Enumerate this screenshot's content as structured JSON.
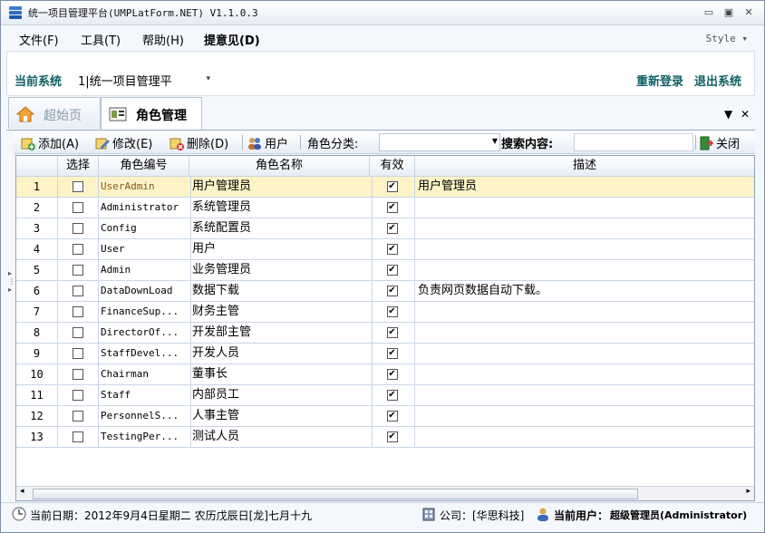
{
  "window": {
    "title": "统一项目管理平台(UMPLatForm.NET) V1.1.0.3",
    "controls": {
      "minimize": "▭",
      "restore": "▣",
      "close": "✕"
    }
  },
  "menu": {
    "items": [
      "文件(F)",
      "工具(T)",
      "帮助(H)",
      "提意见(D)"
    ],
    "style_label": "Style ▾"
  },
  "system": {
    "label": "当前系统",
    "selected": "1|统一项目管理平",
    "relogin": "重新登录",
    "logout": "退出系统"
  },
  "tabs": [
    {
      "label": "超始页",
      "icon": "home-icon",
      "active": false
    },
    {
      "label": "角色管理",
      "icon": "role-management-icon",
      "active": true
    }
  ],
  "toolbar": {
    "add": "添加(A)",
    "edit": "修改(E)",
    "delete": "删除(D)",
    "user": "用户",
    "category_label": "角色分类:",
    "category_value": "",
    "search_label": "搜索内容:",
    "search_value": "",
    "close": "关闭"
  },
  "grid": {
    "columns": [
      "选择",
      "角色编号",
      "角色名称",
      "有效",
      "描述"
    ],
    "rows": [
      {
        "num": "1",
        "code": "UserAdmin",
        "name": "用户管理员",
        "valid": true,
        "desc": "用户管理员",
        "checked": false
      },
      {
        "num": "2",
        "code": "Administrator",
        "name": "系统管理员",
        "valid": true,
        "desc": "",
        "checked": false
      },
      {
        "num": "3",
        "code": "Config",
        "name": "系统配置员",
        "valid": true,
        "desc": "",
        "checked": false
      },
      {
        "num": "4",
        "code": "User",
        "name": "用户",
        "valid": true,
        "desc": "",
        "checked": false
      },
      {
        "num": "5",
        "code": "Admin",
        "name": "业务管理员",
        "valid": true,
        "desc": "",
        "checked": false
      },
      {
        "num": "6",
        "code": "DataDownLoad",
        "name": "数据下载",
        "valid": true,
        "desc": "负责网页数据自动下载。",
        "checked": false
      },
      {
        "num": "7",
        "code": "FinanceSup...",
        "name": "财务主管",
        "valid": true,
        "desc": "",
        "checked": false
      },
      {
        "num": "8",
        "code": "DirectorOf...",
        "name": "开发部主管",
        "valid": true,
        "desc": "",
        "checked": false
      },
      {
        "num": "9",
        "code": "StaffDevel...",
        "name": "开发人员",
        "valid": true,
        "desc": "",
        "checked": false
      },
      {
        "num": "10",
        "code": "Chairman",
        "name": "董事长",
        "valid": true,
        "desc": "",
        "checked": false
      },
      {
        "num": "11",
        "code": "Staff",
        "name": "内部员工",
        "valid": true,
        "desc": "",
        "checked": false
      },
      {
        "num": "12",
        "code": "PersonnelS...",
        "name": "人事主管",
        "valid": true,
        "desc": "",
        "checked": false
      },
      {
        "num": "13",
        "code": "TestingPer...",
        "name": "测试人员",
        "valid": true,
        "desc": "",
        "checked": false
      }
    ],
    "selected_row": 1
  },
  "status": {
    "date": "当前日期：2012年9月4日星期二 农历戊辰日[龙]七月十九",
    "company": "公司：[华思科技]",
    "user_label": "当前用户：",
    "user_value": "超级管理员(Administrator)"
  },
  "colors": {
    "accent": "#0f6066",
    "selected_row": "#fdf3c6",
    "grid_line": "#c9d6e6"
  }
}
